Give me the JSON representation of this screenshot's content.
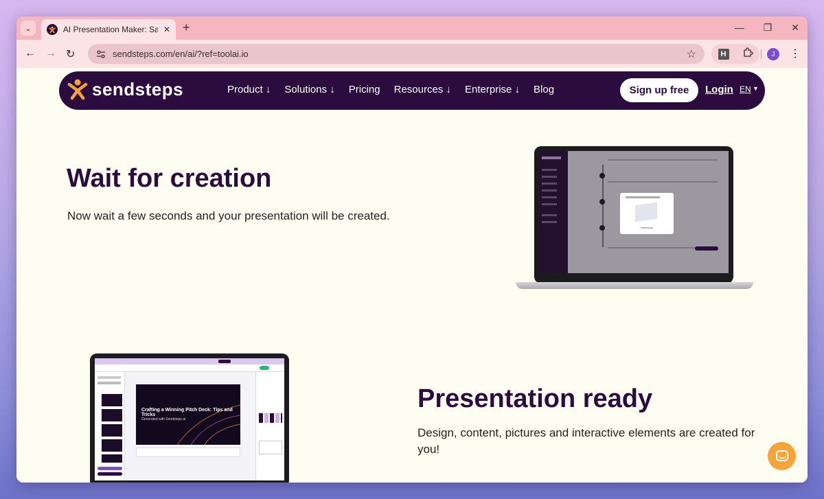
{
  "browser": {
    "tab_title": "AI Presentation Maker: Save Tim",
    "url": "sendsteps.com/en/ai/?ref=toolai.io",
    "extension_label": "H",
    "profile_initial": "J",
    "new_tab": "+",
    "close_tab": "✕"
  },
  "navbar": {
    "logo": "sendsteps",
    "links": [
      {
        "label": "Product",
        "has_dropdown": true
      },
      {
        "label": "Solutions",
        "has_dropdown": true
      },
      {
        "label": "Pricing",
        "has_dropdown": false
      },
      {
        "label": "Resources",
        "has_dropdown": true
      },
      {
        "label": "Enterprise",
        "has_dropdown": true
      },
      {
        "label": "Blog",
        "has_dropdown": false
      }
    ],
    "signup_label": "Sign up free",
    "login_label": "Login",
    "language": "EN"
  },
  "sections": [
    {
      "title": "Wait for creation",
      "text": "Now wait a few seconds and your presentation will be created."
    },
    {
      "title": "Presentation ready",
      "text": "Design, content, pictures and interactive elements are created for you!"
    }
  ],
  "laptop2": {
    "slide_title": "Crafting a Winning Pitch Deck: Tips and Tricks",
    "slide_subtitle": "Generated with Sendsteps.ai"
  },
  "colors": {
    "brand_dark": "#2c0b3e",
    "accent_orange": "#f4a43a",
    "page_bg": "#fdfdf1"
  }
}
